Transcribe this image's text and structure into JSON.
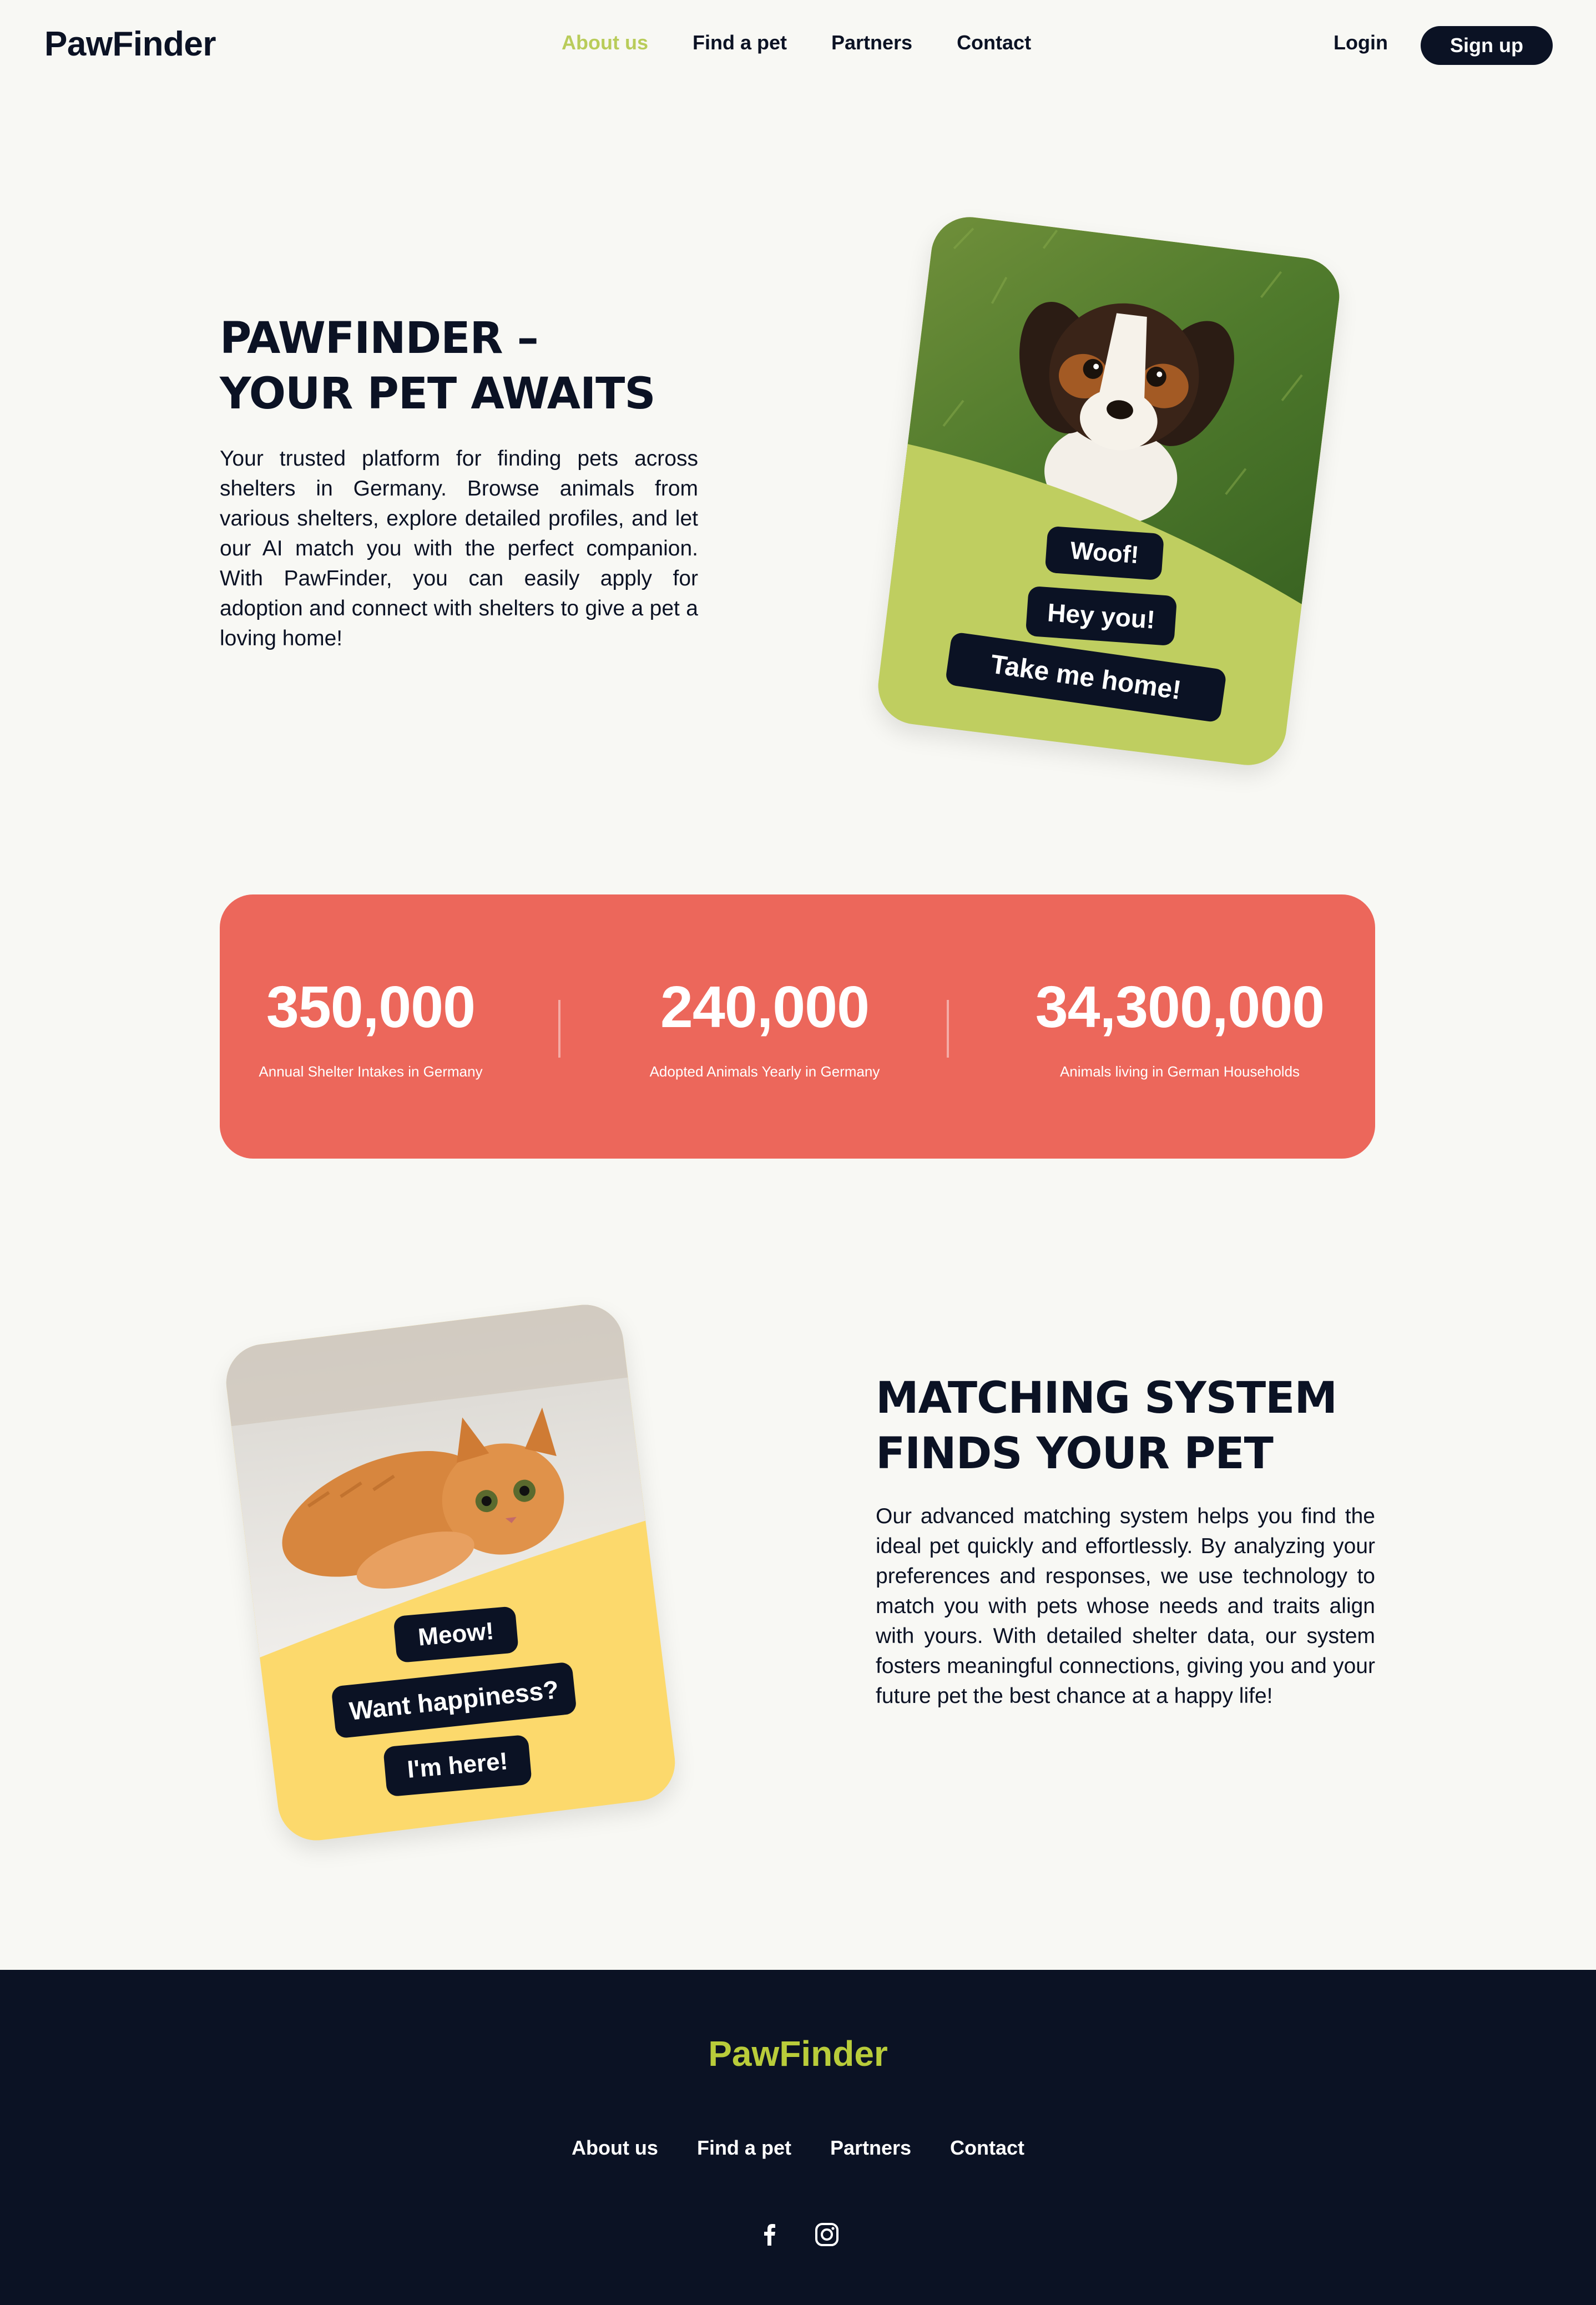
{
  "nav": {
    "logo": "PawFinder",
    "links": [
      "About us",
      "Find a pet",
      "Partners",
      "Contact"
    ],
    "active_link": "About us",
    "login": "Login",
    "signup": "Sign up"
  },
  "hero": {
    "title_line1": "PAWFINDER –",
    "title_line2": "YOUR PET AWAITS",
    "text": "Your trusted platform for finding pets across shelters in Germany. Browse animals from various shelters, explore detailed profiles, and let our AI match you with the perfect companion. With PawFinder, you can easily apply for adoption and connect with shelters to give a pet a loving home!",
    "card_bubbles": [
      "Woof!",
      "Hey you!",
      "Take me home!"
    ]
  },
  "stats": [
    {
      "value": "350,000",
      "label": "Annual Shelter Intakes in Germany"
    },
    {
      "value": "240,000",
      "label": "Adopted Animals Yearly in Germany"
    },
    {
      "value": "34,300,000",
      "label": "Animals living in German Households"
    }
  ],
  "matching": {
    "title_line1": "MATCHING SYSTEM",
    "title_line2": "FINDS YOUR PET",
    "text": "Our advanced matching system helps you find the ideal pet quickly and effortlessly. By analyzing your preferences and responses, we use technology to match you with pets whose needs and traits align with yours. With detailed shelter data, our system fosters meaningful connections, giving you and your future pet the best chance at a happy life!",
    "card_bubbles": [
      "Meow!",
      "Want happiness?",
      "I'm here!"
    ]
  },
  "footer": {
    "logo": "PawFinder",
    "links": [
      "About us",
      "Find a pet",
      "Partners",
      "Contact"
    ],
    "socials": [
      "facebook-icon",
      "instagram-icon"
    ]
  },
  "colors": {
    "navy": "#0b1224",
    "lime": "#bfce60",
    "coral": "#ec675b",
    "yellow": "#fcd96c",
    "background": "#f8f8f4"
  }
}
